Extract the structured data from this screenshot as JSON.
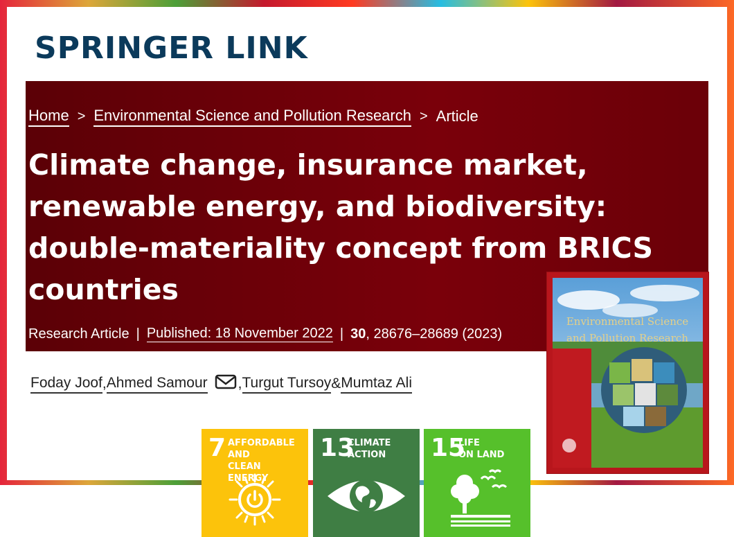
{
  "logo": {
    "text": "SPRINGER LINK"
  },
  "breadcrumb": {
    "items": [
      "Home",
      "Environmental Science and Pollution Research",
      "Article"
    ],
    "separator": ">"
  },
  "article": {
    "title": "Climate change, insurance market, renewable energy, and biodiversity: double-materiality concept from BRICS countries",
    "type": "Research Article",
    "published": "Published: 18 November 2022",
    "volume": "30",
    "pages_year": ", 28676–28689 (2023)"
  },
  "authors": [
    {
      "name": "Foday Joof",
      "after": ", "
    },
    {
      "name": "Ahmed Samour",
      "after": ""
    },
    {
      "name": "Turgut Tursoy",
      "after": " & "
    },
    {
      "name": "Mumtaz Ali",
      "after": ""
    }
  ],
  "author_sep_after_mail": ", ",
  "journal_cover": {
    "title_line1": "Environmental Science",
    "title_line2": "and Pollution Research"
  },
  "sdgs": [
    {
      "number": "7",
      "line1": "AFFORDABLE AND",
      "line2": "CLEAN ENERGY",
      "color": "#fcc30b",
      "icon": "sun-power-icon"
    },
    {
      "number": "13",
      "line1": "CLIMATE",
      "line2": "ACTION",
      "color": "#3f7e44",
      "icon": "earth-eye-icon"
    },
    {
      "number": "15",
      "line1": "LIFE",
      "line2": "ON LAND",
      "color": "#56c02b",
      "icon": "tree-birds-icon"
    }
  ],
  "colors": {
    "hero": "#6b0008",
    "logo": "#0b3a5b",
    "cover_red": "#b8161c"
  }
}
